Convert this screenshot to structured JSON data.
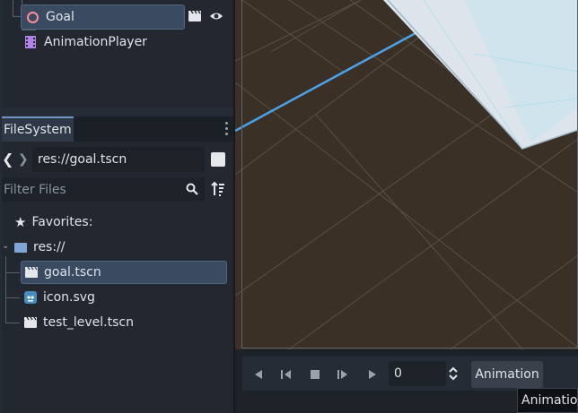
{
  "scene_tree": {
    "nodes": [
      {
        "label": "Goal",
        "icon": "area-circle-icon",
        "selected": true
      },
      {
        "label": "AnimationPlayer",
        "icon": "animation-player-icon",
        "selected": false
      }
    ]
  },
  "filesystem": {
    "tab_label": "FileSystem",
    "path": "res://goal.tscn",
    "filter_placeholder": "Filter Files",
    "favorites_label": "Favorites:",
    "root_label": "res://",
    "files": [
      {
        "name": "goal.tscn",
        "icon": "scene-icon",
        "selected": true
      },
      {
        "name": "icon.svg",
        "icon": "godot-icon",
        "selected": false
      },
      {
        "name": "test_level.tscn",
        "icon": "scene-icon",
        "selected": false
      }
    ]
  },
  "animation_toolbar": {
    "time_value": "0",
    "animation_button_label": "Animation",
    "tooltip": "Animation"
  },
  "colors": {
    "accent": "#4aa3e8",
    "floor": "#3b3026",
    "selection": "#3a4a60"
  }
}
